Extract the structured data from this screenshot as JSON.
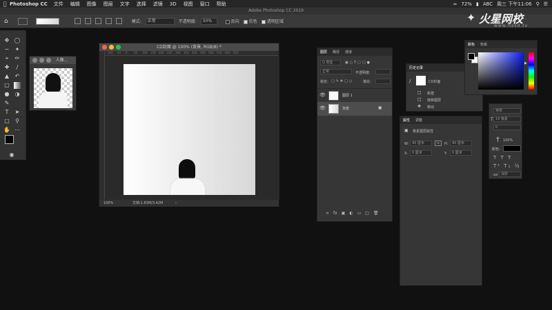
{
  "menubar": {
    "apple": "",
    "app_name": "Photoshop CC",
    "items": [
      "文件",
      "编辑",
      "图像",
      "图层",
      "文字",
      "选择",
      "滤镜",
      "3D",
      "视图",
      "窗口",
      "帮助"
    ],
    "battery": "72%",
    "abc": "ABC",
    "clock": "周三 下午11:06"
  },
  "app_title": "Adobe Photoshop CC 2019",
  "watermark": {
    "brand": "火星网校",
    "url": "www.hxsd.tv"
  },
  "options": {
    "mode_label": "模式:",
    "mode_value": "正常",
    "opacity_label": "不透明度:",
    "opacity_value": "50%",
    "reverse_label": "反向",
    "dither_label": "仿色",
    "transparency_label": "透明区域"
  },
  "doc_window": {
    "title": "CD封面 @ 100% (背景, RGB/8) *",
    "zoom": "100%",
    "docsize": "文档:1.83M/3.42M",
    "ruler_marks": [
      "100",
      "50",
      "0",
      "50",
      "100",
      "150",
      "200",
      "250",
      "300",
      "350",
      "400",
      "450",
      "500",
      "550",
      "600",
      "650"
    ]
  },
  "thumb_window": {
    "title": "人像..."
  },
  "layers_panel": {
    "tabs": [
      "图层",
      "路径",
      "通道"
    ],
    "filter_label": "Q 类型",
    "blend": "正常",
    "opacity_label": "不透明度:",
    "lock_label": "锁定:",
    "fill_label": "填充:",
    "layers": [
      {
        "name": "图层 1",
        "selected": false
      },
      {
        "name": "背景",
        "selected": true
      }
    ],
    "footer_icons": [
      "link-icon",
      "fx-icon",
      "mask-icon",
      "adjustment-icon",
      "folder-icon",
      "new-layer-icon",
      "trash-icon"
    ]
  },
  "history_panel": {
    "title": "历史记录",
    "snapshot": "CD封面",
    "items": [
      "新建",
      "拖移图层",
      "移动"
    ]
  },
  "properties_panel": {
    "tabs": [
      "属性",
      "调整"
    ],
    "subtitle": "像素图层属性",
    "w_label": "W:",
    "w_value": "40 厘米",
    "h_label": "H:",
    "h_value": "40 厘米",
    "x_label": "X:",
    "x_value": "0 厘米",
    "y_label": "Y:",
    "y_value": "0 厘米"
  },
  "color_panel": {
    "tabs": [
      "颜色",
      "色板"
    ]
  },
  "char_panel": {
    "style": "常规",
    "size": "19 像素",
    "tracking": "0",
    "scale": "100%",
    "color_label": "颜色:",
    "aa": "浑厚",
    "aa_label": "aa"
  },
  "colors": {
    "accent_red": "#ff5f57",
    "accent_yellow": "#febc2e",
    "accent_green": "#28c840",
    "bg_dark": "#111111",
    "panel": "#363636"
  }
}
